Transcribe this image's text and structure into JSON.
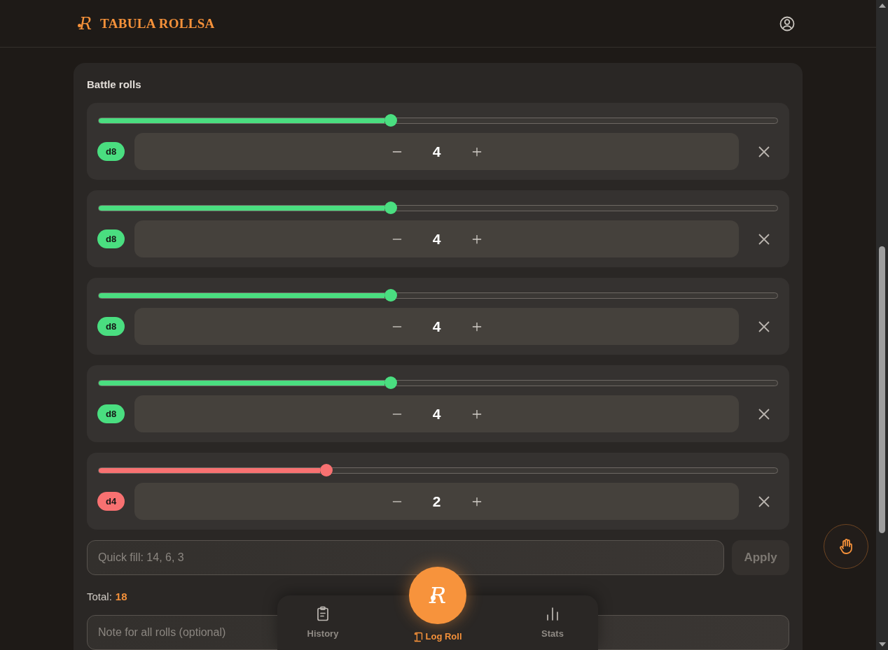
{
  "header": {
    "logo_mark": "R",
    "brand": "TABULA ROLLSA"
  },
  "panel": {
    "title": "Battle rolls"
  },
  "rolls": [
    {
      "die": "d8",
      "value": "4",
      "level": 0.43,
      "color": "#4ade80"
    },
    {
      "die": "d8",
      "value": "4",
      "level": 0.43,
      "color": "#4ade80"
    },
    {
      "die": "d8",
      "value": "4",
      "level": 0.43,
      "color": "#4ade80"
    },
    {
      "die": "d8",
      "value": "4",
      "level": 0.43,
      "color": "#4ade80"
    },
    {
      "die": "d4",
      "value": "2",
      "level": 0.335,
      "color": "#f87171"
    }
  ],
  "quick_fill": {
    "placeholder": "Quick fill: 14, 6, 3",
    "apply": {
      "label": "Apply",
      "disabled": true
    }
  },
  "total": {
    "label": "Total:",
    "value": "18"
  },
  "note": {
    "placeholder": "Note for all rolls (optional)"
  },
  "fab": {
    "mark": "R"
  },
  "nav": [
    {
      "label": "History",
      "selected": false
    },
    {
      "label": "Log Roll",
      "selected": true
    },
    {
      "label": "Stats",
      "selected": false
    }
  ]
}
